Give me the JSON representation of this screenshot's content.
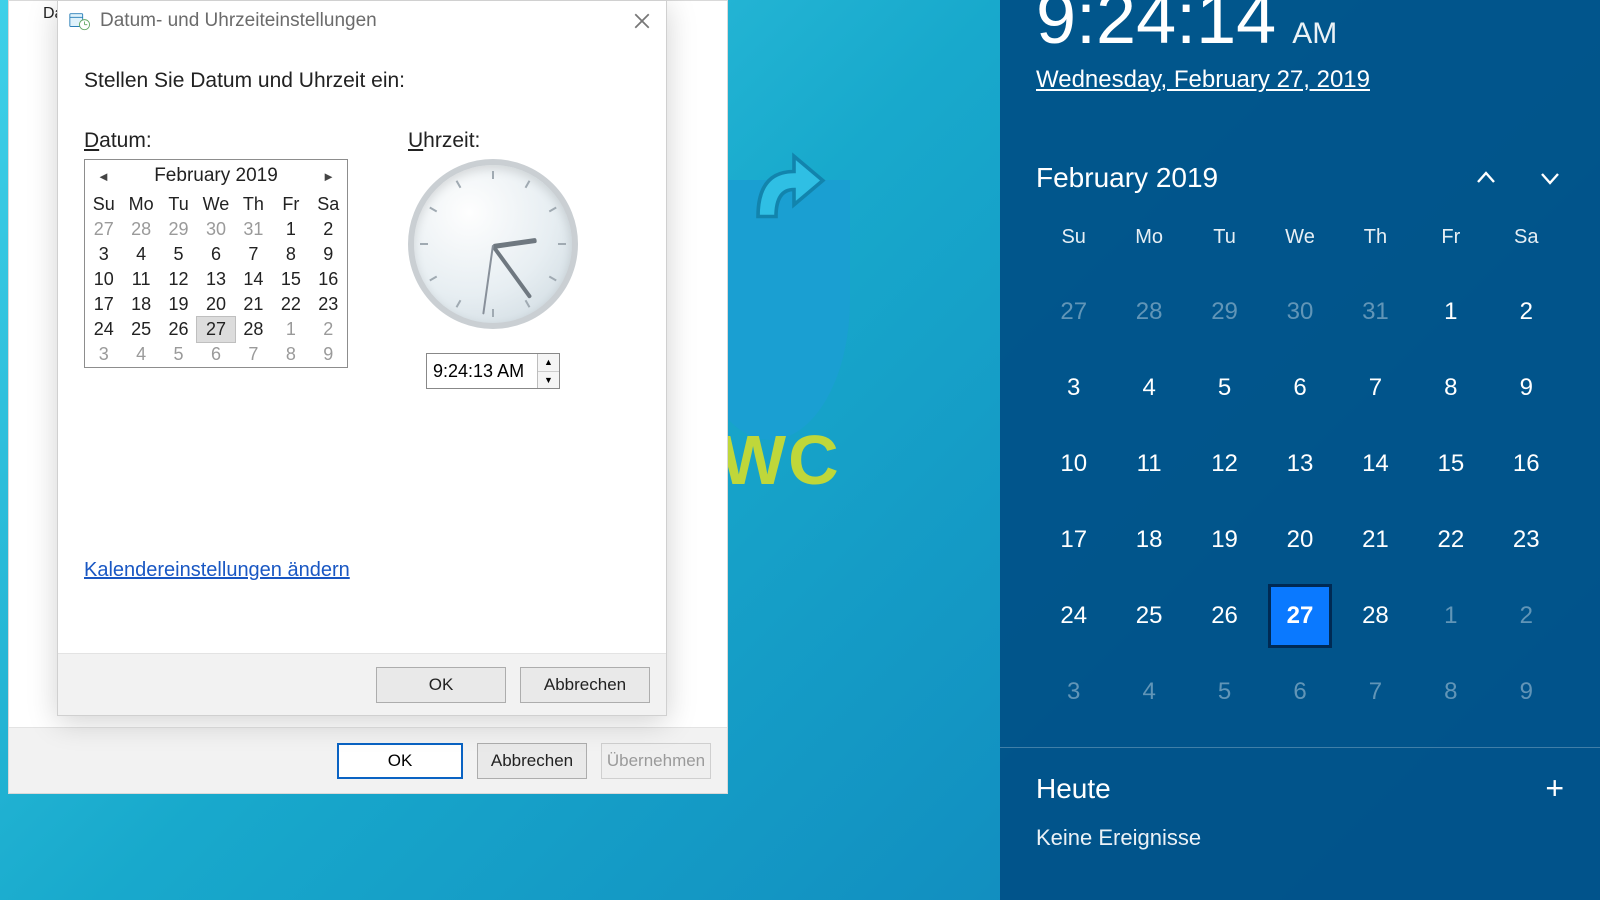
{
  "background": {
    "logo_text": "WC"
  },
  "parent": {
    "tab_prefix": "Dat",
    "ok": "OK",
    "cancel": "Abbrechen",
    "apply": "Übernehmen"
  },
  "dialog": {
    "title": "Datum- und Uhrzeiteinstellungen",
    "prompt": "Stellen Sie Datum und Uhrzeit ein:",
    "date_label_initial": "D",
    "date_label_rest": "atum:",
    "time_label_initial": "U",
    "time_label_rest": "hrzeit:",
    "mini_calendar": {
      "title": "February 2019",
      "dow": [
        "Su",
        "Mo",
        "Tu",
        "We",
        "Th",
        "Fr",
        "Sa"
      ],
      "rows": [
        [
          {
            "d": "27",
            "dim": true
          },
          {
            "d": "28",
            "dim": true
          },
          {
            "d": "29",
            "dim": true
          },
          {
            "d": "30",
            "dim": true
          },
          {
            "d": "31",
            "dim": true
          },
          {
            "d": "1"
          },
          {
            "d": "2"
          }
        ],
        [
          {
            "d": "3"
          },
          {
            "d": "4"
          },
          {
            "d": "5"
          },
          {
            "d": "6"
          },
          {
            "d": "7"
          },
          {
            "d": "8"
          },
          {
            "d": "9"
          }
        ],
        [
          {
            "d": "10"
          },
          {
            "d": "11"
          },
          {
            "d": "12"
          },
          {
            "d": "13"
          },
          {
            "d": "14"
          },
          {
            "d": "15"
          },
          {
            "d": "16"
          }
        ],
        [
          {
            "d": "17"
          },
          {
            "d": "18"
          },
          {
            "d": "19"
          },
          {
            "d": "20"
          },
          {
            "d": "21"
          },
          {
            "d": "22"
          },
          {
            "d": "23"
          }
        ],
        [
          {
            "d": "24"
          },
          {
            "d": "25"
          },
          {
            "d": "26"
          },
          {
            "d": "27",
            "sel": true
          },
          {
            "d": "28"
          },
          {
            "d": "1",
            "dim": true
          },
          {
            "d": "2",
            "dim": true
          }
        ],
        [
          {
            "d": "3",
            "dim": true
          },
          {
            "d": "4",
            "dim": true
          },
          {
            "d": "5",
            "dim": true
          },
          {
            "d": "6",
            "dim": true
          },
          {
            "d": "7",
            "dim": true
          },
          {
            "d": "8",
            "dim": true
          },
          {
            "d": "9",
            "dim": true
          }
        ]
      ]
    },
    "time_value": "9:24:13 AM",
    "link": "Kalendereinstellungen ändern",
    "ok": "OK",
    "cancel": "Abbrechen"
  },
  "flyout": {
    "clock": "9:24:14",
    "ampm": "AM",
    "date": "Wednesday, February 27, 2019",
    "month": "February 2019",
    "dow": [
      "Su",
      "Mo",
      "Tu",
      "We",
      "Th",
      "Fr",
      "Sa"
    ],
    "rows": [
      [
        {
          "d": "27",
          "dim": true
        },
        {
          "d": "28",
          "dim": true
        },
        {
          "d": "29",
          "dim": true
        },
        {
          "d": "30",
          "dim": true
        },
        {
          "d": "31",
          "dim": true
        },
        {
          "d": "1"
        },
        {
          "d": "2"
        }
      ],
      [
        {
          "d": "3"
        },
        {
          "d": "4"
        },
        {
          "d": "5"
        },
        {
          "d": "6"
        },
        {
          "d": "7"
        },
        {
          "d": "8"
        },
        {
          "d": "9"
        }
      ],
      [
        {
          "d": "10"
        },
        {
          "d": "11"
        },
        {
          "d": "12"
        },
        {
          "d": "13"
        },
        {
          "d": "14"
        },
        {
          "d": "15"
        },
        {
          "d": "16"
        }
      ],
      [
        {
          "d": "17"
        },
        {
          "d": "18"
        },
        {
          "d": "19"
        },
        {
          "d": "20"
        },
        {
          "d": "21"
        },
        {
          "d": "22"
        },
        {
          "d": "23"
        }
      ],
      [
        {
          "d": "24"
        },
        {
          "d": "25"
        },
        {
          "d": "26"
        },
        {
          "d": "27",
          "sel": true
        },
        {
          "d": "28"
        },
        {
          "d": "1",
          "dim": true
        },
        {
          "d": "2",
          "dim": true
        }
      ],
      [
        {
          "d": "3",
          "dim": true
        },
        {
          "d": "4",
          "dim": true
        },
        {
          "d": "5",
          "dim": true
        },
        {
          "d": "6",
          "dim": true
        },
        {
          "d": "7",
          "dim": true
        },
        {
          "d": "8",
          "dim": true
        },
        {
          "d": "9",
          "dim": true
        }
      ]
    ],
    "today": "Heute",
    "no_events": "Keine Ereignisse"
  }
}
